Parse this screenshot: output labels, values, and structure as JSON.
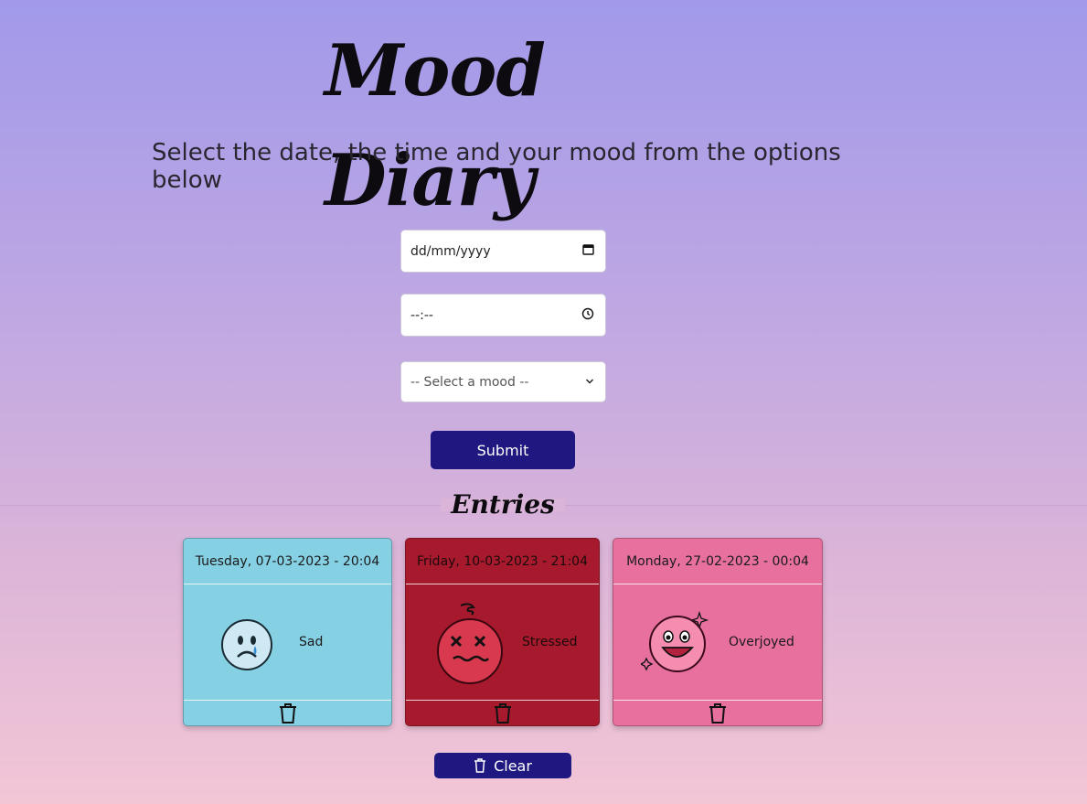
{
  "app": {
    "title": "Mood Diary",
    "subtitle": "Select the date, the time and your mood from the options below"
  },
  "form": {
    "date_value": "dd/mm/yyyy",
    "time_value": "--:--",
    "mood_value": "-- Select a mood --",
    "submit_label": "Submit"
  },
  "entries": {
    "title": "Entries",
    "items": [
      {
        "datetime": "Tuesday, 07-03-2023 - 20:04",
        "mood": "Sad",
        "color": "#85d0e3",
        "icon": "sad-face-icon"
      },
      {
        "datetime": "Friday, 10-03-2023 - 21:04",
        "mood": "Stressed",
        "color": "#a71a2d",
        "icon": "stressed-face-icon"
      },
      {
        "datetime": "Monday, 27-02-2023 - 00:04",
        "mood": "Overjoyed",
        "color": "#e7709e",
        "icon": "overjoyed-face-icon"
      }
    ],
    "clear_label": "Clear"
  },
  "colors": {
    "accent": "#1f1880",
    "background_top": "#a199ea",
    "background_bottom": "#f3c6d6"
  }
}
